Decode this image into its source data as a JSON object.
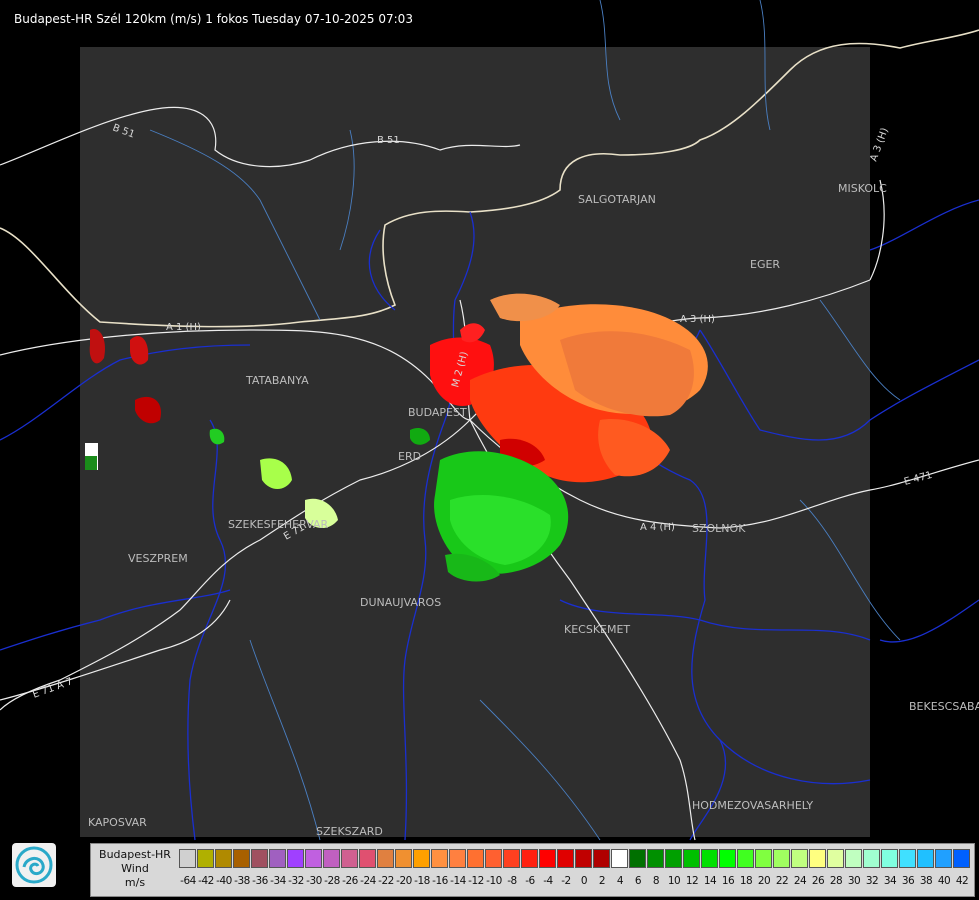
{
  "title": "Budapest-HR Szél 120km (m/s) 1 fokos Tuesday 07-10-2025 07:03",
  "cities": [
    {
      "name": "SALGOTARJAN"
    },
    {
      "name": "EGER"
    },
    {
      "name": "MISKOLC"
    },
    {
      "name": "TATABANYA"
    },
    {
      "name": "BUDAPEST"
    },
    {
      "name": "ERD"
    },
    {
      "name": "SZEKESFEHERVAR"
    },
    {
      "name": "VESZPREM"
    },
    {
      "name": "DUNAUJVAROS"
    },
    {
      "name": "KECSKEMET"
    },
    {
      "name": "SZOLNOK"
    },
    {
      "name": "BEKESCSABA"
    },
    {
      "name": "HODMEZOVASARHELY"
    },
    {
      "name": "KAPOSVAR"
    },
    {
      "name": "SZEKSZARD"
    }
  ],
  "roads": [
    "B 51",
    "B 51",
    "A 1 (H)",
    "M 2 (H)",
    "A 3 (H)",
    "A 3 (H)",
    "A 4 (H)",
    "E 71",
    "E 71 A 7",
    "E 471"
  ],
  "legend": {
    "station": "Budapest-HR",
    "product": "Wind",
    "unit": "m/s",
    "colors": [
      "#d0d0d0",
      "#b0b000",
      "#b08a00",
      "#a86000",
      "#a05060",
      "#a060c0",
      "#a040ff",
      "#c060e0",
      "#c060c0",
      "#d06090",
      "#e05070",
      "#e08040",
      "#f09030",
      "#ffa000",
      "#ff9040",
      "#ff8040",
      "#ff7030",
      "#ff6030",
      "#ff4020",
      "#ff2010",
      "#ff0000",
      "#e00000",
      "#c00000",
      "#b00000",
      "#ffffff",
      "#007000",
      "#009000",
      "#00a000",
      "#00c000",
      "#00e000",
      "#00ff00",
      "#40ff20",
      "#80ff40",
      "#a0ff60",
      "#c0ff80",
      "#ffff80",
      "#e0ffa0",
      "#c0ffc0",
      "#a0ffd0",
      "#80ffe0",
      "#40e0ff",
      "#20c0ff",
      "#20a0ff",
      "#0060ff",
      "#0030ff",
      "#0000ff"
    ],
    "ticks": [
      "-64",
      "-42",
      "-40",
      "-38",
      "-36",
      "-34",
      "-32",
      "-30",
      "-28",
      "-26",
      "-24",
      "-22",
      "-20",
      "-18",
      "-16",
      "-14",
      "-12",
      "-10",
      "-8",
      "-6",
      "-4",
      "-2",
      "0",
      "2",
      "4",
      "6",
      "8",
      "10",
      "12",
      "14",
      "16",
      "18",
      "20",
      "22",
      "24",
      "26",
      "28",
      "30",
      "32",
      "34",
      "36",
      "38",
      "40",
      "42"
    ]
  }
}
